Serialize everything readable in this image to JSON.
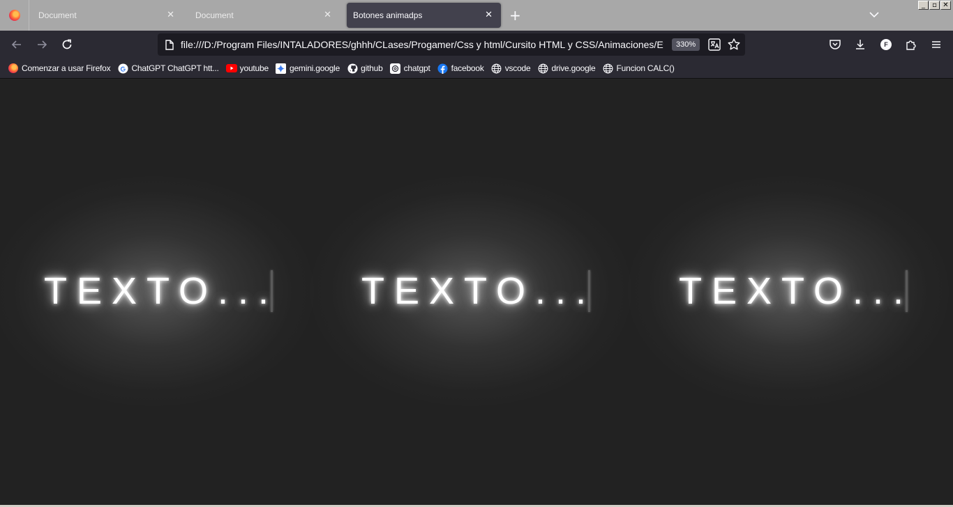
{
  "window": {
    "minimize": "_",
    "restore": "▫",
    "close": "✕"
  },
  "tabs": [
    {
      "label": "Document",
      "active": false
    },
    {
      "label": "Document",
      "active": false
    },
    {
      "label": "Botones animadps",
      "active": true
    }
  ],
  "tab_close_glyph": "✕",
  "new_tab_glyph": "+",
  "urlbar": {
    "url": "file:///D:/Program Files/INTALADORES/ghhh/CLases/Progamer/Css y html/Cursito HTML y CSS/Animaciones/Efectos",
    "zoom": "330%"
  },
  "account_initial": "F",
  "bookmarks": [
    {
      "label": "Comenzar a usar Firefox",
      "icon": "firefox-icon"
    },
    {
      "label": "ChatGPT ChatGPT htt...",
      "icon": "google-icon"
    },
    {
      "label": "youtube",
      "icon": "youtube-icon"
    },
    {
      "label": "gemini.google",
      "icon": "gemini-icon"
    },
    {
      "label": "github",
      "icon": "github-icon"
    },
    {
      "label": "chatgpt",
      "icon": "chatgpt-icon"
    },
    {
      "label": "facebook",
      "icon": "facebook-icon"
    },
    {
      "label": "vscode",
      "icon": "globe-icon"
    },
    {
      "label": "drive.google",
      "icon": "globe-icon"
    },
    {
      "label": "Funcion CALC()",
      "icon": "globe-icon"
    }
  ],
  "content": {
    "background": "#222222",
    "items": [
      {
        "text": "TEXTO..."
      },
      {
        "text": "TEXTO..."
      },
      {
        "text": "TEXTO..."
      }
    ]
  }
}
